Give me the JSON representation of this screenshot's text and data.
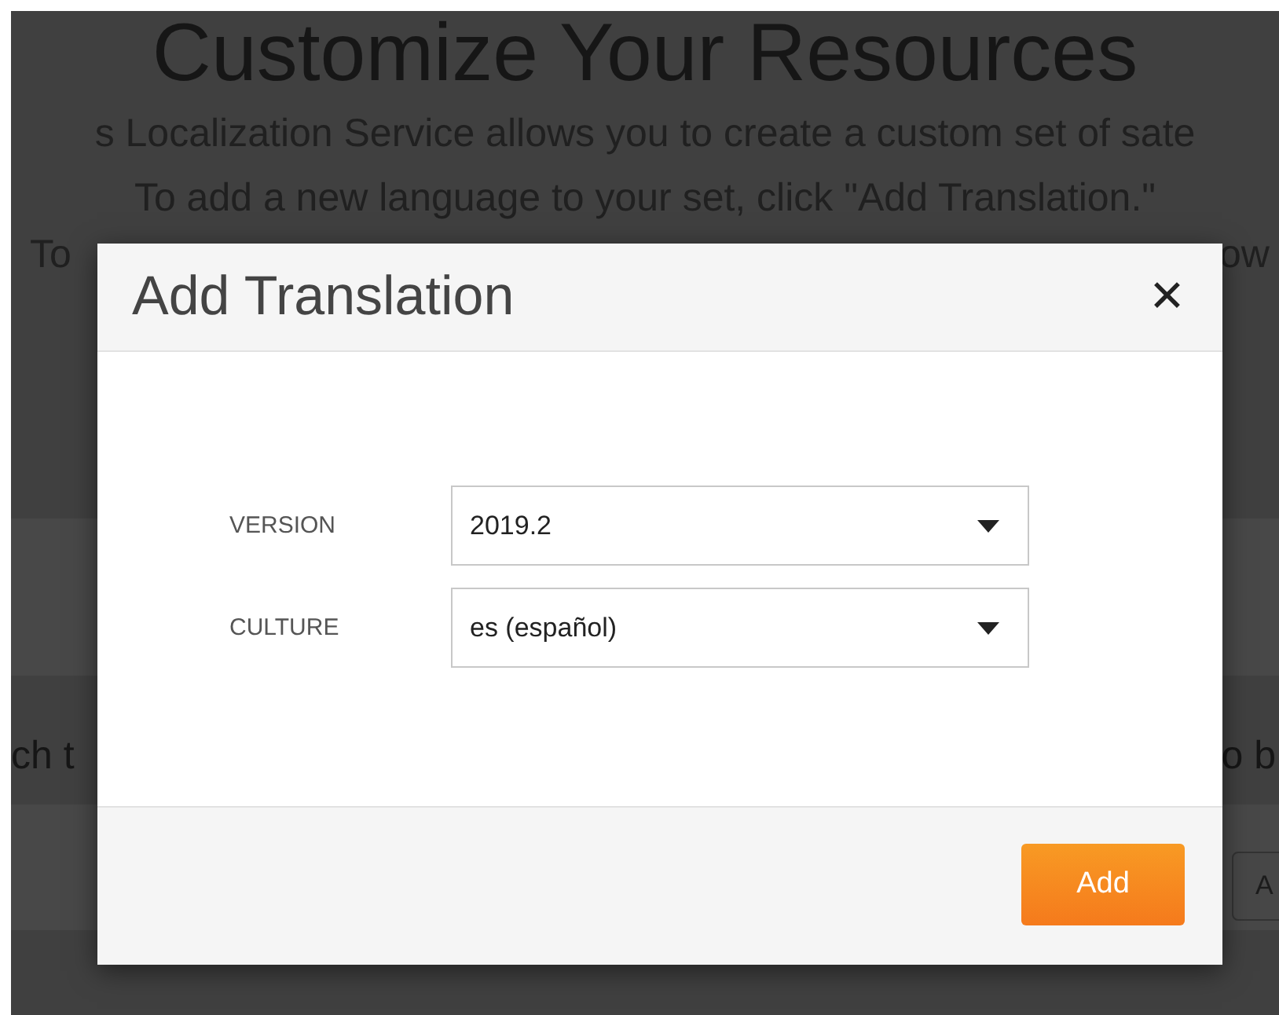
{
  "background_page": {
    "heading": "Customize Your Resources",
    "intro_lines": [
      "s Localization Service allows you to create a custom set of sate",
      "To add a new language to your set, click \"Add Translation.\""
    ],
    "partial_line_1": {
      "left": "To",
      "right": "ow"
    },
    "partial_line_2": {
      "left": "ch t",
      "right": "o b"
    },
    "partial_button": "A"
  },
  "dialog": {
    "title": "Add Translation",
    "close": "✕",
    "fields": [
      {
        "label": "VERSION",
        "value": "2019.2"
      },
      {
        "label": "CULTURE",
        "value": "es (español)"
      }
    ],
    "primary_button": "Add"
  }
}
